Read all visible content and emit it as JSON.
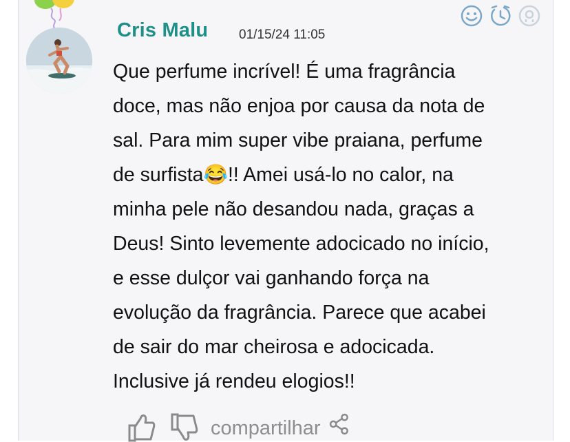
{
  "review": {
    "username": "Cris Malu",
    "timestamp": "01/15/24 11:05",
    "text": "Que perfume incrível! É uma fragrância\ndoce, mas não enjoa por causa da nota de\nsal. Para mim super vibe praiana, perfume\nde surfista😂!! Amei usá-lo no calor, na\nminha pele não desandou nada, graças a\nDeus! Sinto levemente adocicado no início,\ne esse dulçor vai ganhando força na\nevolução da fragrância. Parece que acabei\nde sair do mar cheirosa e adocicada.\nInclusive já rendeu elogios!!"
  },
  "actions": {
    "share_label": "compartilhar"
  },
  "icons": {
    "top": [
      "smile-icon",
      "clock-icon",
      "user-icon"
    ],
    "bottom": [
      "thumbs-up-icon",
      "thumbs-down-icon",
      "share-icon"
    ]
  },
  "colors": {
    "username": "#1f8f8a",
    "icon_blue": "#7aa7c7",
    "muted": "#8e8e8e",
    "card_bg": "#f6f6f8"
  }
}
